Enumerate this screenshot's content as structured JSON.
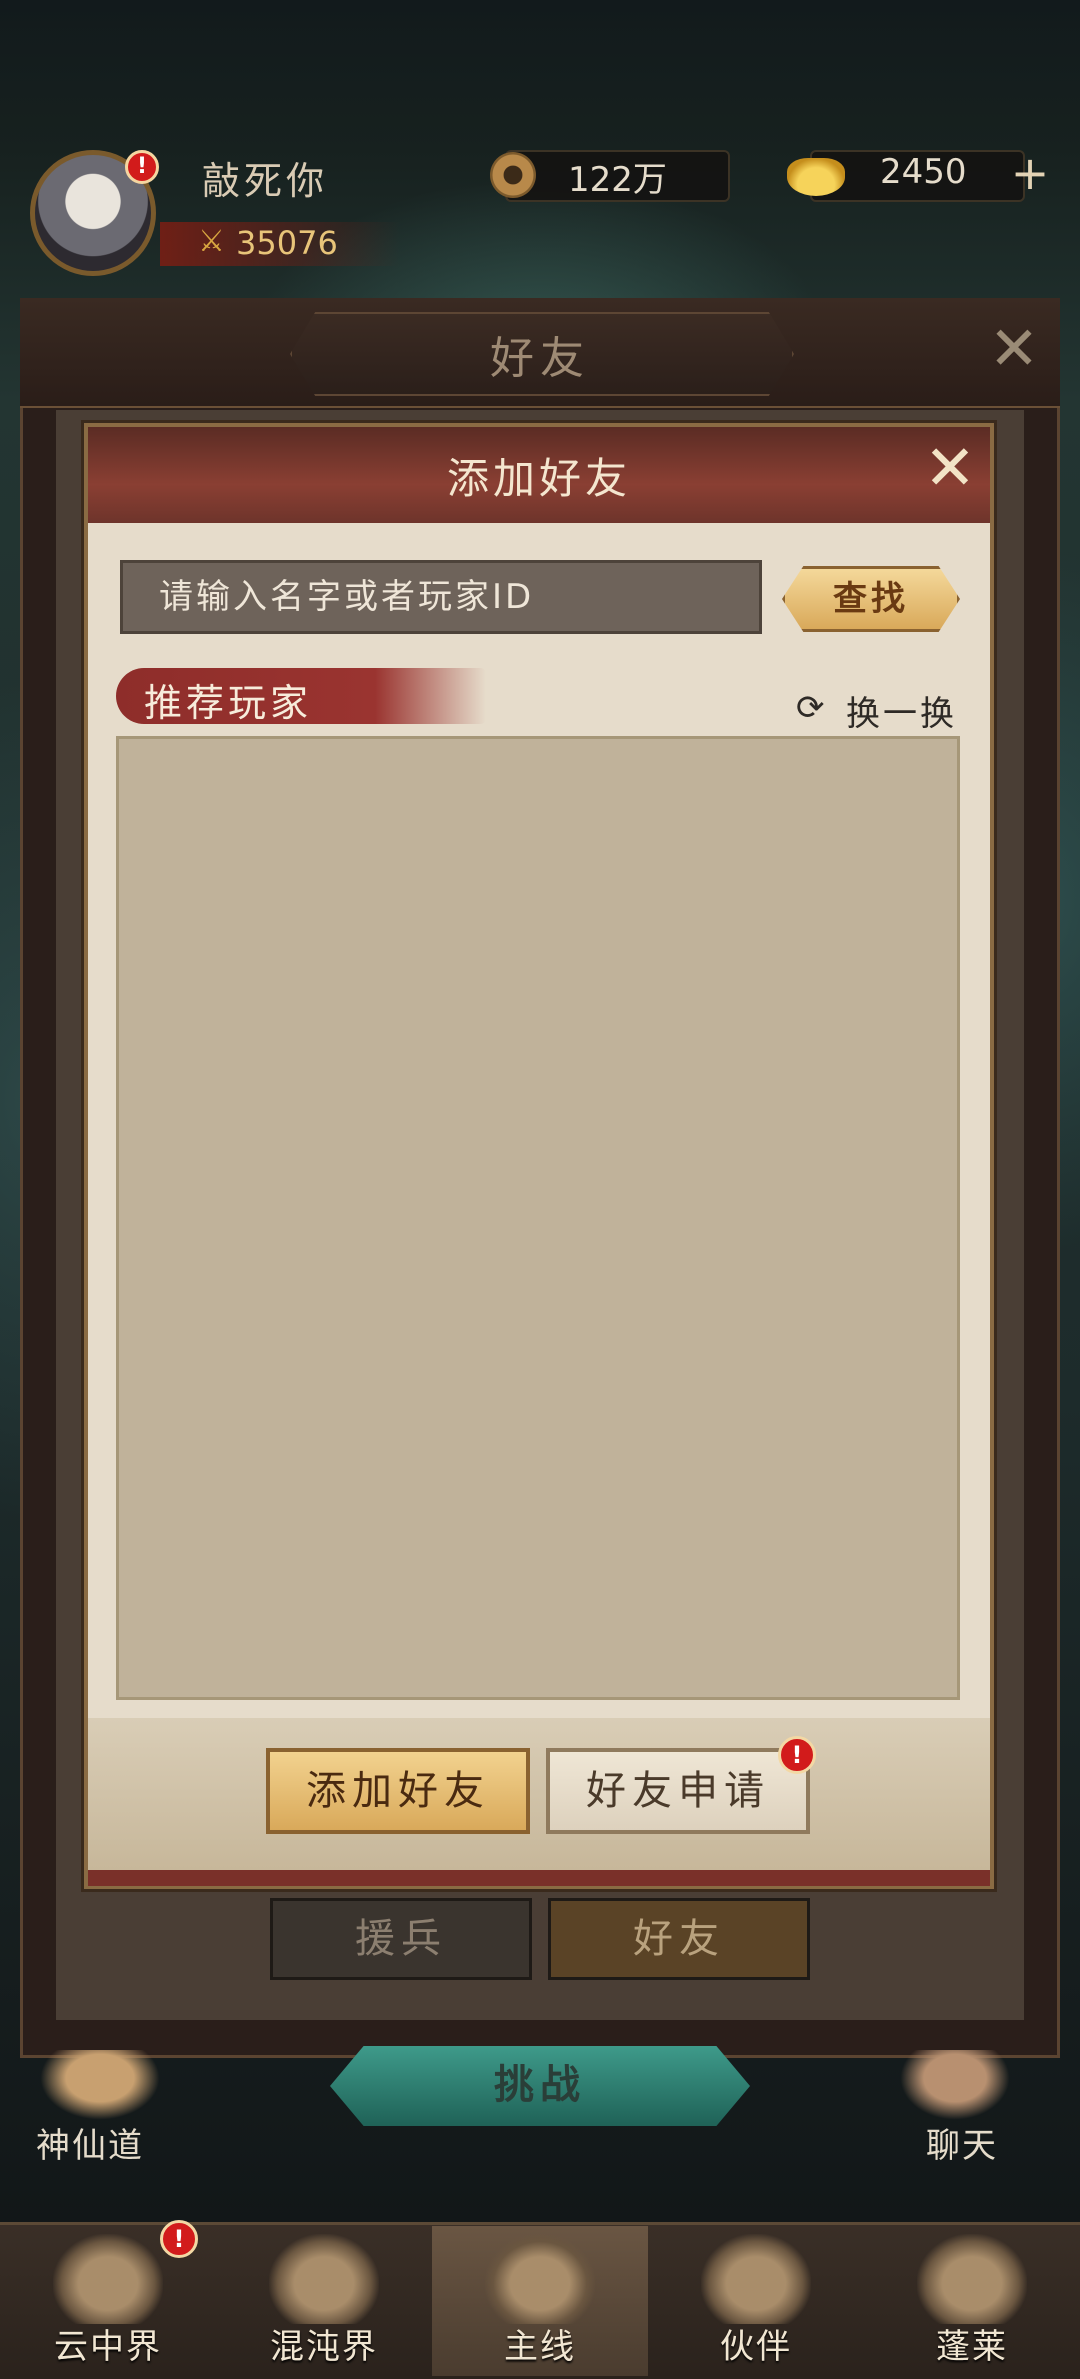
{
  "top_bar": {
    "player_name": "敲死你",
    "power_value": "35076",
    "coins": "122万",
    "gold": "2450",
    "avatar_badge": "!",
    "plus_icon": "+"
  },
  "friend_panel": {
    "title": "好友",
    "tabs": [
      {
        "label": "援兵",
        "active": false
      },
      {
        "label": "好友",
        "active": true
      }
    ]
  },
  "add_friend_dialog": {
    "title": "添加好友",
    "search_placeholder": "请输入名字或者玩家ID",
    "search_button": "查找",
    "recommended_label": "推荐玩家",
    "refresh_label": "换一换",
    "recommended_players": [],
    "footer_buttons": {
      "add_friend": "添加好友",
      "friend_requests": "好友申请"
    },
    "request_badge": "!"
  },
  "scene": {
    "challenge_label": "挑战",
    "left_icon_label": "神仙道",
    "right_icon_label": "聊天"
  },
  "bottom_nav": {
    "items": [
      {
        "label": "云中界",
        "icon": "pagoda-icon",
        "badge": "!"
      },
      {
        "label": "混沌界",
        "icon": "portal-icon"
      },
      {
        "label": "主线",
        "icon": "crossed-swords-icon",
        "active": true
      },
      {
        "label": "伙伴",
        "icon": "companion-icon"
      },
      {
        "label": "蓬莱",
        "icon": "sage-icon"
      }
    ]
  },
  "colors": {
    "modal_header": "#8a3f33",
    "accent_gold": "#d9a95a",
    "badge_red": "#d21b1b"
  }
}
